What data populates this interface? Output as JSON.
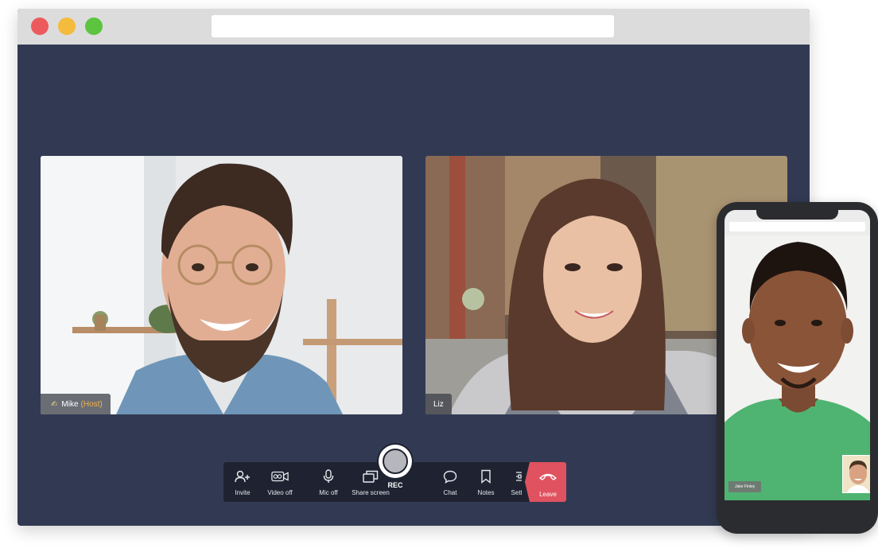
{
  "window": {
    "traffic_lights": [
      "close",
      "minimize",
      "maximize"
    ],
    "url": ""
  },
  "participants": {
    "mike": {
      "hand_icon": "✍",
      "name": "Mike",
      "role": "(Host)"
    },
    "liz": {
      "name": "Liz"
    },
    "phone": {
      "name": "Jake Finley"
    }
  },
  "controls": {
    "invite": "Invite",
    "video": "Video off",
    "mic": "Mic off",
    "share": "Share screen",
    "rec": "REC",
    "chat": "Chat",
    "notes": "Notes",
    "settings": "Settings",
    "leave": "Leave"
  },
  "colors": {
    "background": "#323a53",
    "control_bar": "#1f2331",
    "leave": "#e0525f",
    "host_accent": "#f2b04f"
  }
}
